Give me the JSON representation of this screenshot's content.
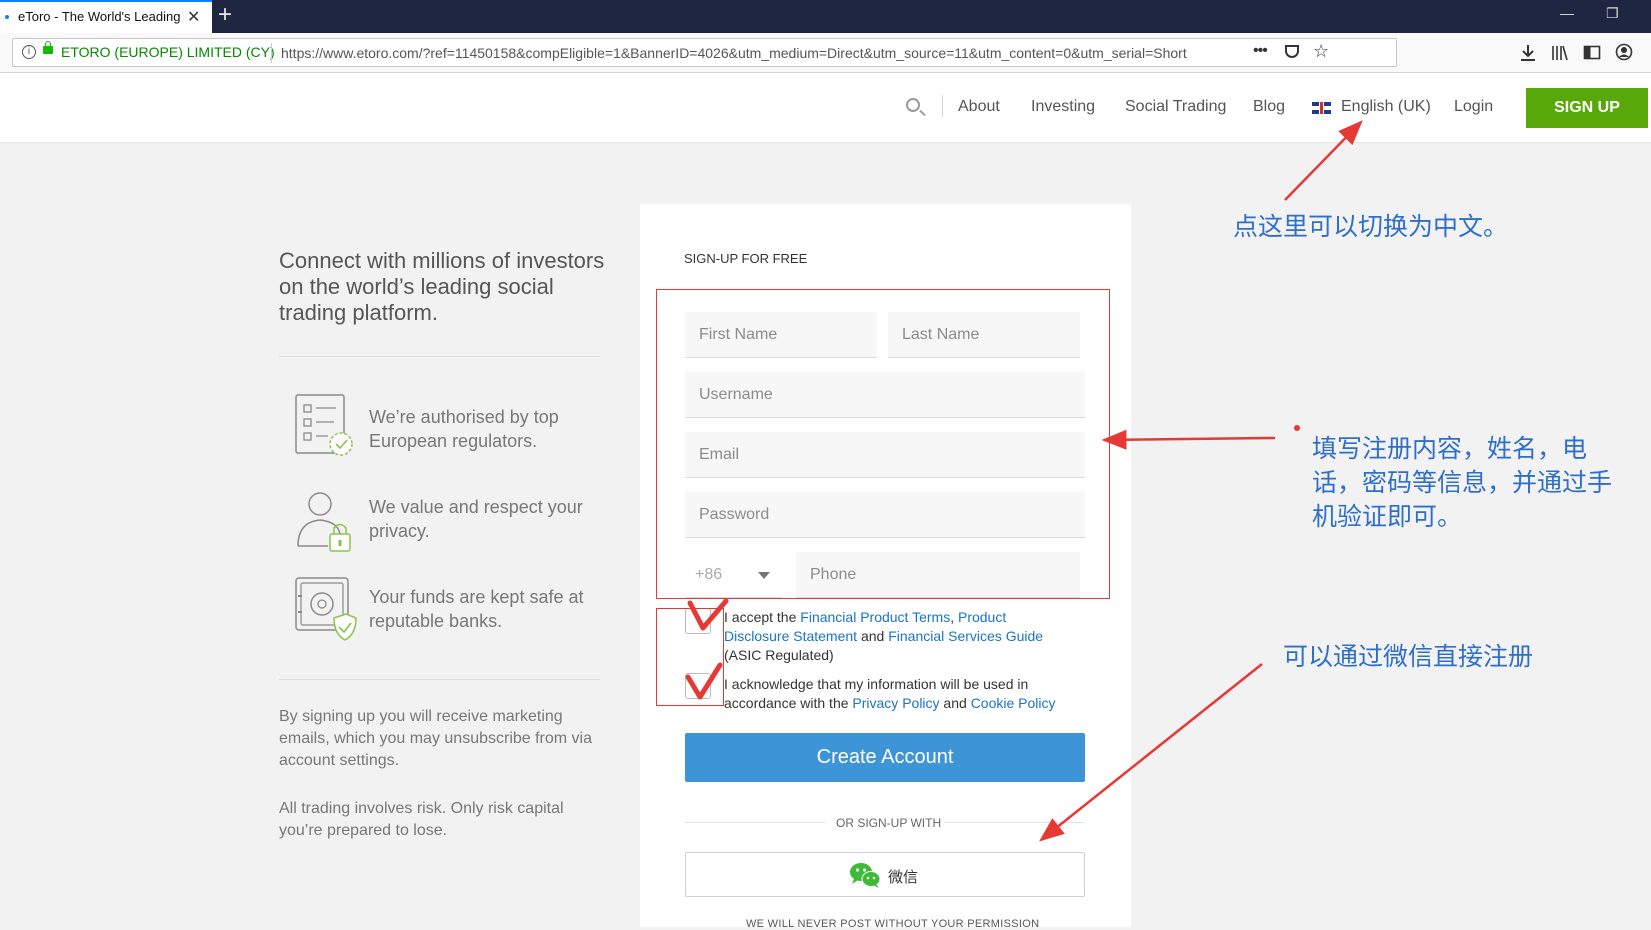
{
  "browser": {
    "tab_title": "eToro - The World's Leading",
    "tab_close": "✕",
    "new_tab": "+",
    "win_minimize": "—",
    "win_restore": "❐",
    "org_label": "ETORO (EUROPE) LIMITED (CY)",
    "url": "https://www.etoro.com/?ref=11450158&compEligible=1&BannerID=4026&utm_medium=Direct&utm_source=11&utm_content=0&utm_serial=Short",
    "more_label": "•••",
    "star": "☆"
  },
  "header": {
    "nav": [
      "About",
      "Investing",
      "Social Trading",
      "Blog"
    ],
    "language": "English (UK)",
    "login": "Login",
    "signup": "SIGN UP"
  },
  "left": {
    "headline": "Connect with millions of investors on the world’s leading social trading platform.",
    "features": [
      "We’re authorised by top European regulators.",
      "We value and respect your privacy.",
      "Your funds are kept safe at reputable banks."
    ],
    "note1": "By signing up you will receive marketing emails, which you may unsubscribe from via account settings.",
    "note2": "All trading involves risk. Only risk capital you’re prepared to lose."
  },
  "form": {
    "title": "SIGN-UP FOR FREE",
    "first_name": "First Name",
    "last_name": "Last Name",
    "username": "Username",
    "email": "Email",
    "password": "Password",
    "phone_code": "+86",
    "phone": "Phone",
    "consent1": {
      "pre": "I accept the ",
      "link1": "Financial Product Terms",
      "mid1": ", ",
      "link2": "Product Disclosure Statement",
      "mid2": " and ",
      "link3": "Financial Services Guide",
      "post": " (ASIC Regulated)"
    },
    "consent2": {
      "pre": "I acknowledge that my information will be used in accordance with the ",
      "link1": "Privacy Policy",
      "mid": " and ",
      "link2": "Cookie Policy"
    },
    "create": "Create Account",
    "or_signup": "OR SIGN-UP WITH",
    "wechat": "微信",
    "never_post": "WE WILL NEVER POST WITHOUT YOUR PERMISSION"
  },
  "annotations": {
    "language_tip": "点这里可以切换为中文。",
    "form_tip": [
      "填写注册内容，姓名，电",
      "话，密码等信息，并通过手",
      "机验证即可。"
    ],
    "wechat_tip": "可以通过微信直接注册"
  },
  "colors": {
    "annotation_blue": "#2f6fc9",
    "annotation_red": "#e53935",
    "signup_green": "#58a80a",
    "create_blue": "#3d95d8",
    "link_blue": "#1a73c9"
  }
}
